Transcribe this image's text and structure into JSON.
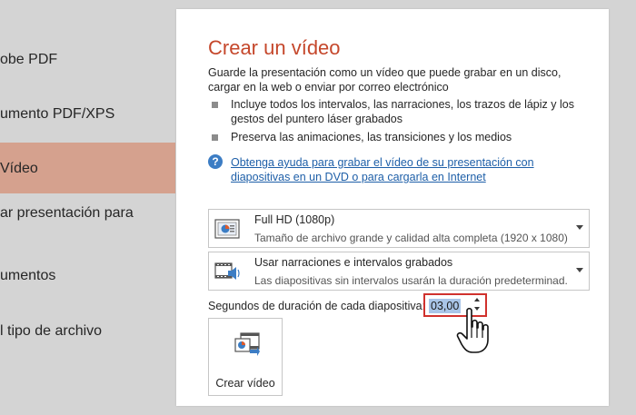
{
  "sidebar": {
    "items": [
      {
        "label": "obe PDF",
        "selected": false
      },
      {
        "label": "umento PDF/XPS",
        "selected": false
      },
      {
        "label": "Vídeo",
        "selected": true
      },
      {
        "label": "ar presentación para",
        "selected": false
      },
      {
        "label": "umentos",
        "selected": false
      },
      {
        "label": "l tipo de archivo",
        "selected": false
      }
    ]
  },
  "panel": {
    "title": "Crear un vídeo",
    "description": "Guarde la presentación como un vídeo que puede grabar en un disco, cargar en la web o enviar por correo electrónico",
    "bullets": [
      "Incluye todos los intervalos, las narraciones, los trazos de lápiz y los gestos del puntero láser grabados",
      "Preserva las animaciones, las transiciones y los medios"
    ],
    "help_link": "Obtenga ayuda para grabar el vídeo de su presentación con diapositivas en un DVD o para cargarla en Internet",
    "quality_dropdown": {
      "icon": "presentation-quality-icon",
      "value": "Full HD (1080p)",
      "description": "Tamaño de archivo grande y calidad alta completa (1920 x 1080)"
    },
    "narration_dropdown": {
      "icon": "film-speaker-icon",
      "value": "Usar narraciones e intervalos grabados",
      "description": "Las diapositivas sin intervalos usarán la duración predeterminad..."
    },
    "seconds_label": "Segundos de duración de cada diapositiva:",
    "seconds_value": "03,00",
    "create_button_label": "Crear vídeo"
  },
  "colors": {
    "accent_title": "#c5472b",
    "selected_sidebar": "#d5a18e",
    "link": "#1e5fa8",
    "highlight_border": "#d0312d"
  }
}
